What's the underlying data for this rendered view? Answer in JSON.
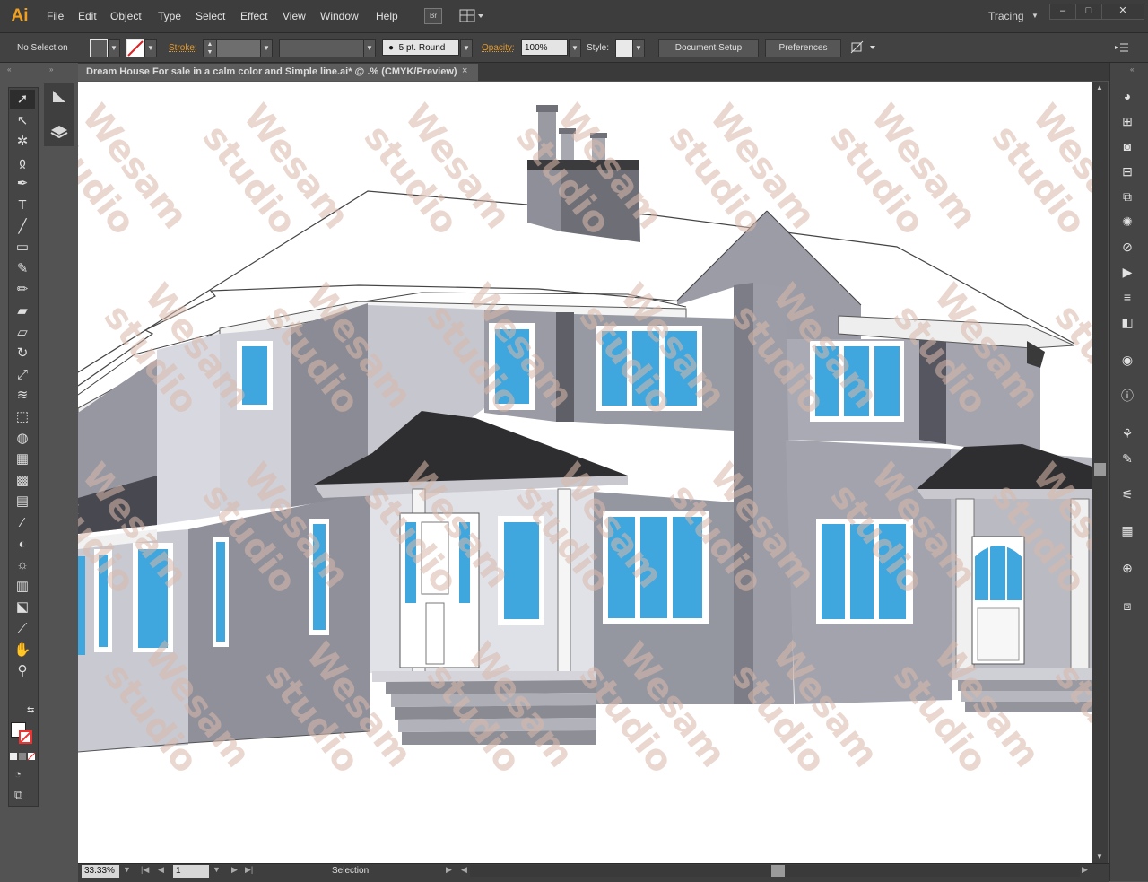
{
  "app": {
    "logo": "Ai"
  },
  "menu": {
    "items": [
      "File",
      "Edit",
      "Object",
      "Type",
      "Select",
      "Effect",
      "View",
      "Window",
      "Help"
    ],
    "bridge_label": "Br",
    "workspace": "Tracing",
    "window_min": "–",
    "window_max": "□",
    "window_close": "✕"
  },
  "control": {
    "selection_status": "No Selection",
    "stroke_label": "Stroke:",
    "brush_value": "5 pt. Round",
    "opacity_label": "Opacity:",
    "opacity_value": "100%",
    "style_label": "Style:",
    "document_setup": "Document Setup",
    "preferences": "Preferences"
  },
  "document": {
    "tab_title": "Dream House For sale in a calm color and Simple line.ai* @ .% (CMYK/Preview)",
    "close": "×"
  },
  "status": {
    "zoom": "33.33%",
    "artboard": "1",
    "tool_status": "Selection"
  },
  "watermark": {
    "line1": "Wesam",
    "line2": "studio"
  },
  "icons": {
    "tools": [
      "selection-tool-icon",
      "direct-selection-tool-icon",
      "magic-wand-tool-icon",
      "lasso-tool-icon",
      "pen-tool-icon",
      "type-tool-icon",
      "line-tool-icon",
      "rectangle-tool-icon",
      "paintbrush-tool-icon",
      "pencil-tool-icon",
      "blob-brush-tool-icon",
      "eraser-tool-icon",
      "rotate-tool-icon",
      "scale-tool-icon",
      "warp-tool-icon",
      "free-transform-tool-icon",
      "shape-builder-tool-icon",
      "perspective-grid-tool-icon",
      "mesh-tool-icon",
      "gradient-tool-icon",
      "eyedropper-tool-icon",
      "blend-tool-icon",
      "symbol-sprayer-tool-icon",
      "column-graph-tool-icon",
      "artboard-tool-icon",
      "slice-tool-icon",
      "hand-tool-icon",
      "zoom-tool-icon"
    ],
    "right_panels": [
      "color-panel-icon",
      "artboards-panel-icon",
      "graphic-styles-icon",
      "align-panel-icon",
      "pathfinder-icon",
      "symbols-icon",
      "links-icon",
      "actions-icon",
      "stroke-panel-icon",
      "gradient-panel-icon",
      "appearance-icon",
      "info-icon",
      "image-trace-icon",
      "brushes-icon",
      "layers-icon",
      "swatches-icon",
      "navigator-icon",
      "transform-icon"
    ]
  },
  "colors": {
    "chrome": "#535353",
    "menubar": "#3d3d3d",
    "accent": "#f0a01e",
    "window_glass": "#3fa6de",
    "wall_dark": "#8d8e97",
    "wall_light": "#c9cad2",
    "roof": "#2f2f2f"
  }
}
